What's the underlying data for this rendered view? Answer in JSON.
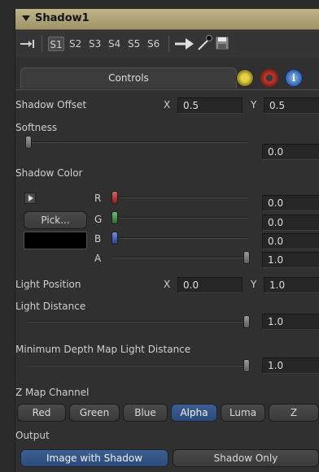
{
  "header": {
    "title": "Shadow1"
  },
  "toolbar": {
    "slots": [
      "S1",
      "S2",
      "S3",
      "S4",
      "S5",
      "S6"
    ]
  },
  "tabs": {
    "controls": "Controls"
  },
  "shadow_offset": {
    "label": "Shadow Offset",
    "x_label": "X",
    "x_value": "0.5",
    "y_label": "Y",
    "y_value": "0.5"
  },
  "softness": {
    "label": "Softness",
    "value": "0.0",
    "level": 0.0
  },
  "shadow_color": {
    "label": "Shadow Color",
    "pick_label": "Pick...",
    "swatch_color": "#000000",
    "r_label": "R",
    "r_value": "0.0",
    "g_label": "G",
    "g_value": "0.0",
    "b_label": "B",
    "b_value": "0.0",
    "a_label": "A",
    "a_value": "1.0"
  },
  "light_position": {
    "label": "Light Position",
    "x_label": "X",
    "x_value": "0.0",
    "y_label": "Y",
    "y_value": "1.0"
  },
  "light_distance": {
    "label": "Light Distance",
    "value": "1.0",
    "level": 1.0
  },
  "min_depth": {
    "label": "Minimum Depth Map Light Distance",
    "value": "1.0",
    "level": 1.0
  },
  "z_map_channel": {
    "label": "Z Map Channel",
    "options": [
      "Red",
      "Green",
      "Blue",
      "Alpha",
      "Luma",
      "Z"
    ],
    "selected": "Alpha"
  },
  "output": {
    "label": "Output",
    "options": [
      "Image with Shadow",
      "Shadow Only"
    ],
    "selected": "Image with Shadow"
  },
  "colors": {
    "header": "#b3a97c",
    "accent": "#3e5f92"
  }
}
